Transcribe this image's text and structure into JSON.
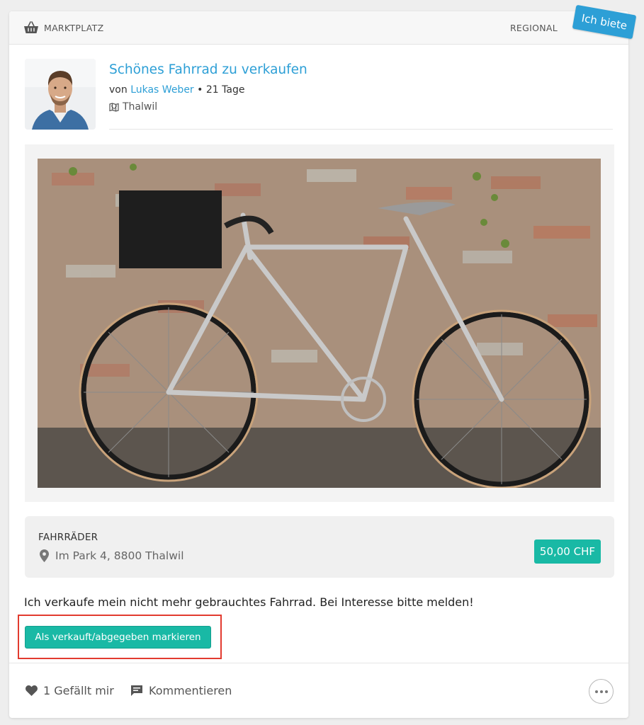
{
  "header": {
    "section_label": "MARKTPLATZ",
    "scope_label": "REGIONAL",
    "ribbon_label": "Ich biete",
    "ribbon_color": "#2d9fd6"
  },
  "post": {
    "title": "Schönes Fahrrad zu verkaufen",
    "by_prefix": "von",
    "author": "Lukas Weber",
    "age": "• 21 Tage",
    "location": "Thalwil",
    "image_description_icon": "bicycle-photo"
  },
  "details": {
    "category": "FAHRRÄDER",
    "address": "Im Park 4, 8800 Thalwil",
    "price": "50,00 CHF",
    "price_color": "#19b9a5"
  },
  "description": "Ich verkaufe mein nicht mehr gebrauchtes Fahrrad. Bei Interesse bitte melden!",
  "actions": {
    "mark_sold_label": "Als verkauft/abgegeben markieren",
    "like_label": "1 Gefällt mir",
    "comment_label": "Kommentieren"
  },
  "colors": {
    "accent": "#2d9fd6",
    "teal": "#19b9a5",
    "highlight": "#e23b2f"
  }
}
